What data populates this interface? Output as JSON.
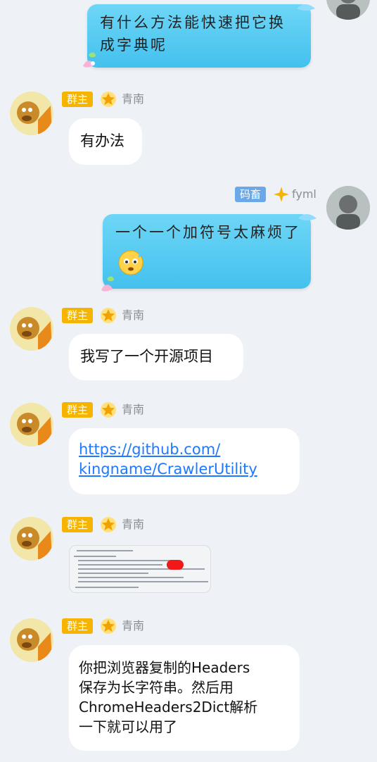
{
  "messages": [
    {
      "sender": "self",
      "text": "有什么方法能快速把它换成字典呢"
    },
    {
      "sender": "other",
      "badge": "群主",
      "nick": "青南",
      "text": "有办法"
    },
    {
      "sender": "self",
      "badge": "码畜",
      "nick": "fyml",
      "text": "一个一个加符号太麻烦了"
    },
    {
      "sender": "other",
      "badge": "群主",
      "nick": "青南",
      "text": "我写了一个开源项目"
    },
    {
      "sender": "other",
      "badge": "群主",
      "nick": "青南",
      "link_line1": "https://github.com/",
      "link_line2": "kingname/CrawlerUtility"
    },
    {
      "sender": "other",
      "badge": "群主",
      "nick": "青南",
      "image": "code-screenshot"
    },
    {
      "sender": "other",
      "badge": "群主",
      "nick": "青南",
      "text_lines": [
        "你把浏览器复制的Headers",
        "保存为长字符串。然后用",
        "ChromeHeaders2Dict解析",
        "一下就可以用了"
      ]
    }
  ],
  "colors": {
    "background": "#eef1f6",
    "owner_badge": "#f5b400",
    "member_badge": "#6aa8e8",
    "blue_bubble": "#4ec8f0",
    "link": "#1f78ff"
  },
  "icons": [
    "dog-avatar-icon",
    "self-avatar-icon",
    "crown-star-icon",
    "bow-decoration-icon",
    "worried-emoji-icon"
  ]
}
